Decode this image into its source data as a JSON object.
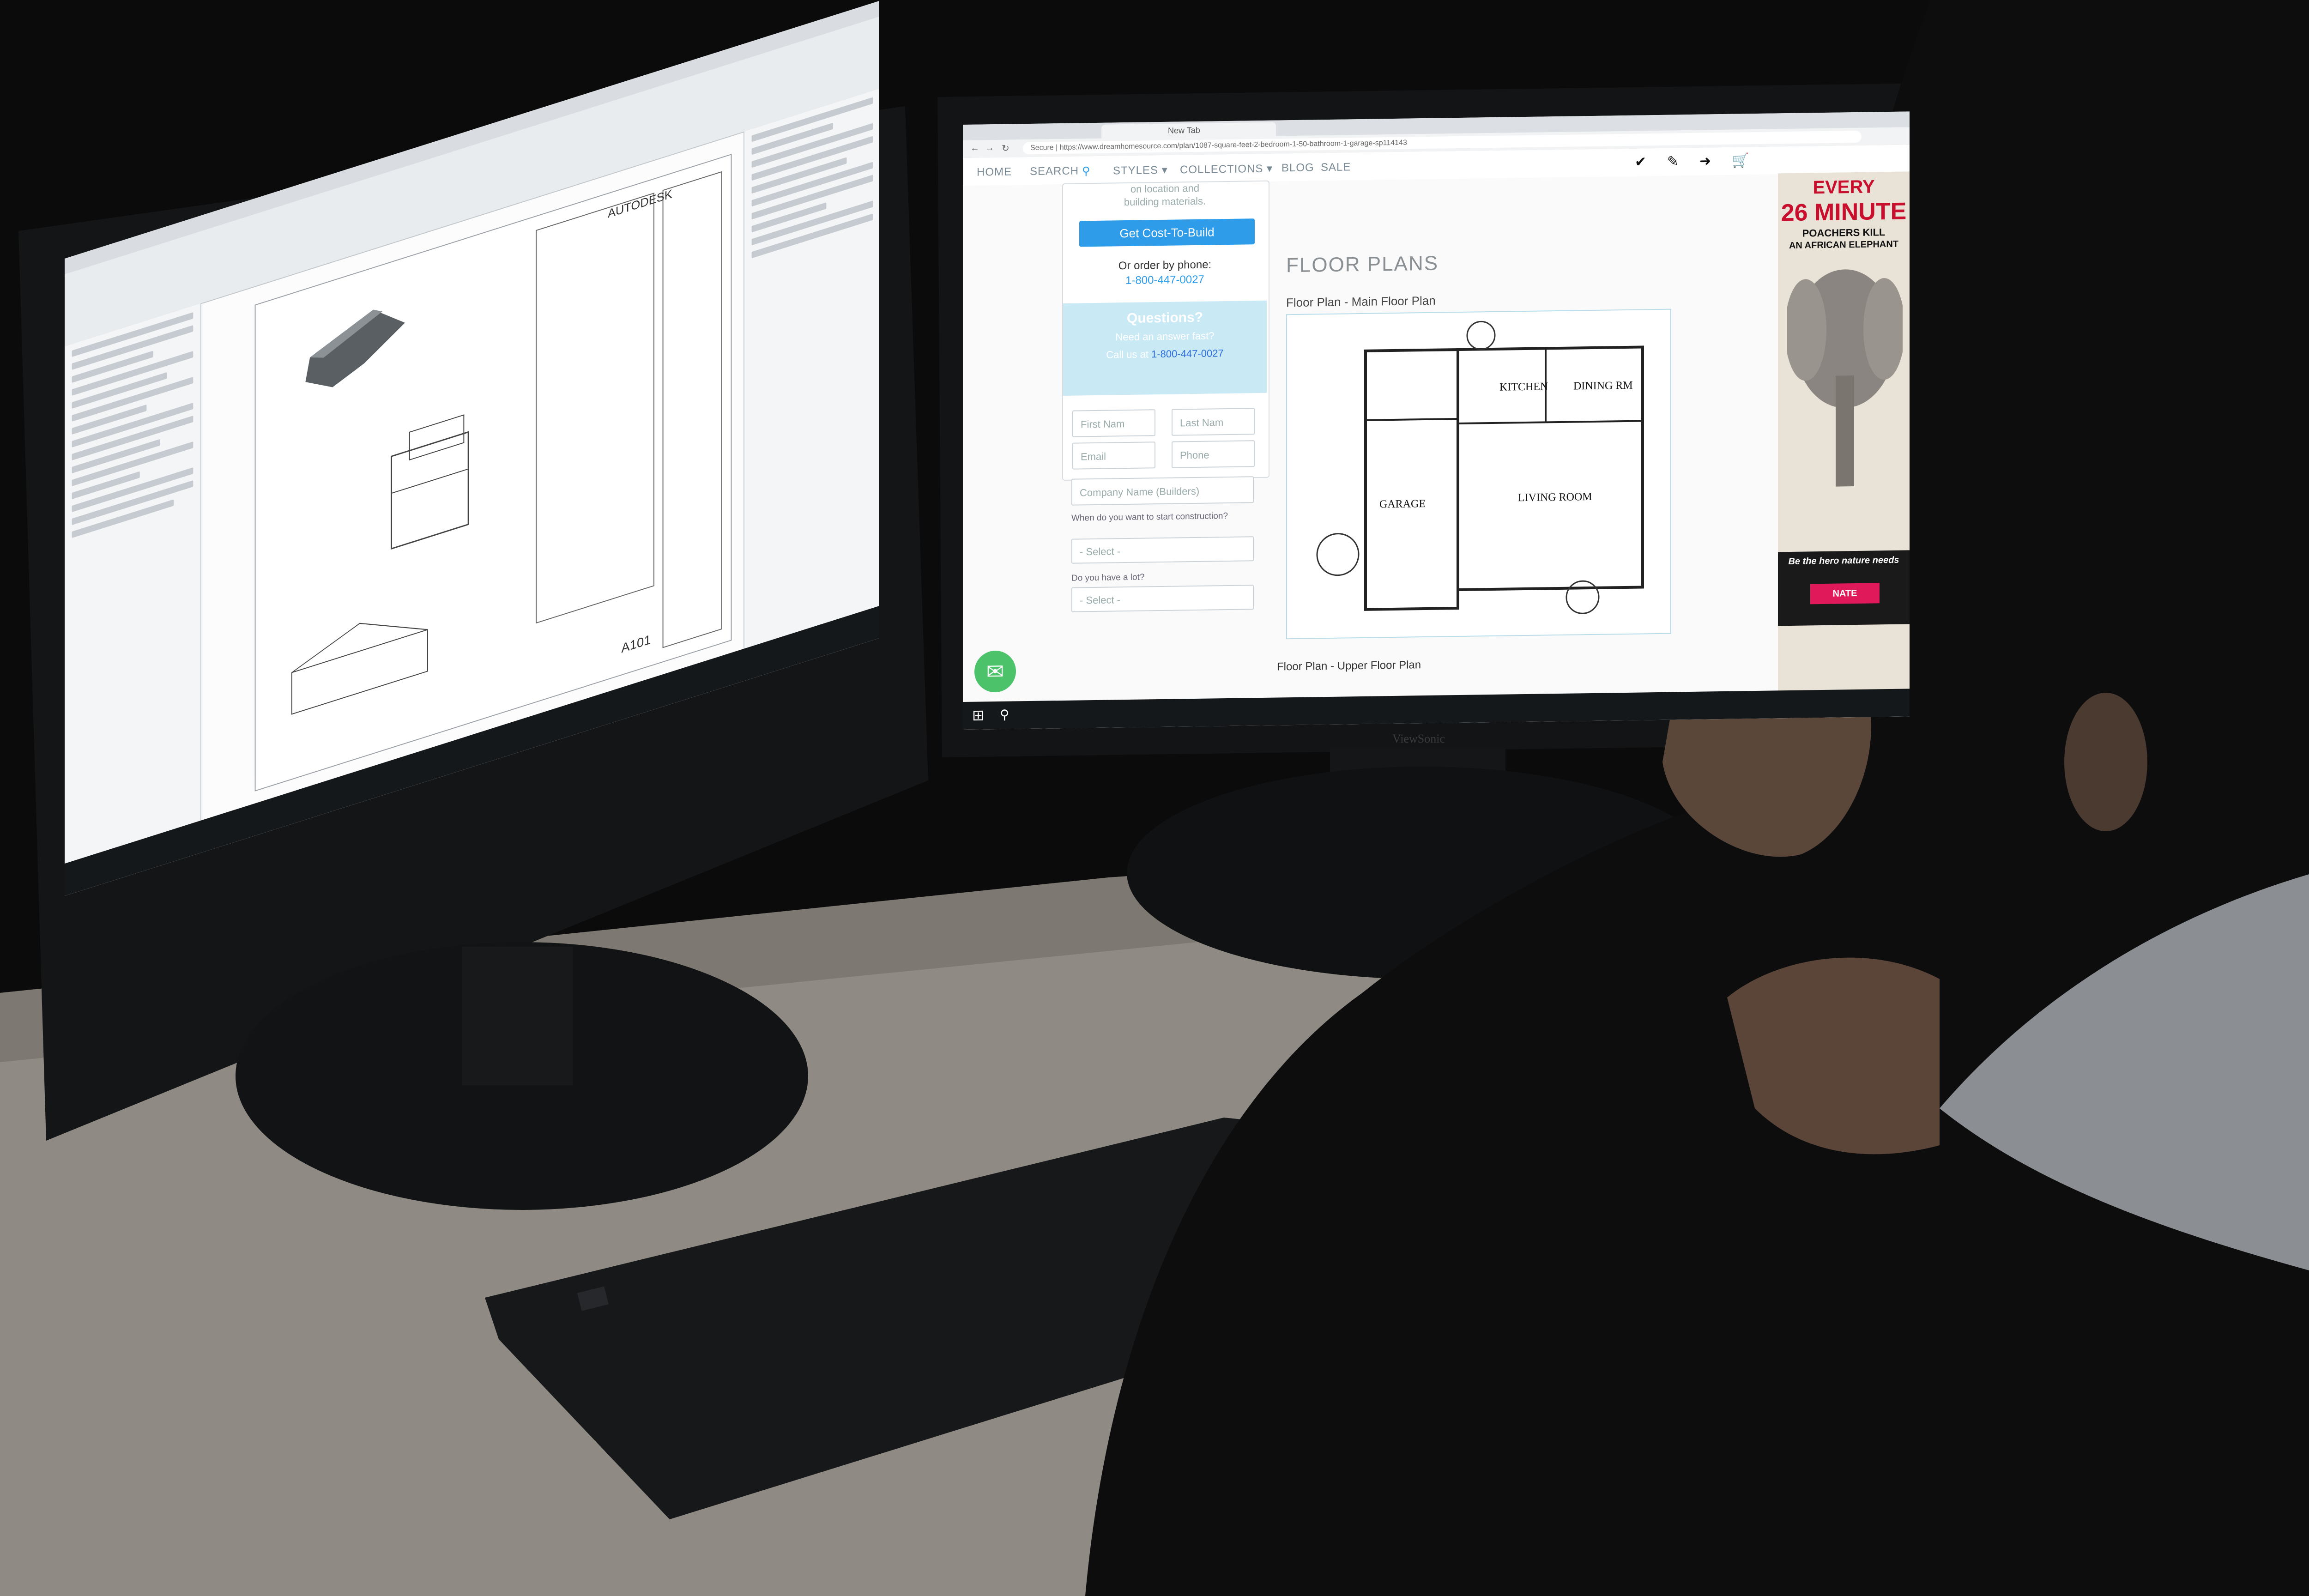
{
  "browser": {
    "tabs": [
      "",
      "New Tab"
    ],
    "address": "Secure  |  https://www.dreamhomesource.com/plan/1087-square-feet-2-bedroom-1-50-bathroom-1-garage-sp114143",
    "nav": {
      "home": "HOME",
      "search": "SEARCH",
      "styles": "STYLES ▾",
      "collections": "COLLECTIONS ▾",
      "blog": "BLOG",
      "sale": "SALE"
    },
    "sidebar": {
      "cost_note_1": "on location and",
      "cost_note_2": "building materials.",
      "cost_button": "Get Cost-To-Build",
      "order_phone_label": "Or order by phone:",
      "order_phone": "1-800-447-0027",
      "questions_title": "Questions?",
      "questions_sub": "Need an answer fast?",
      "call_text": "Call us at",
      "call_phone": "1-800-447-0027",
      "first_name": "First Nam",
      "last_name": "Last Nam",
      "email": "Email",
      "phone": "Phone",
      "company": "Company Name (Builders)",
      "q_when": "When do you want to start construction?",
      "select_placeholder": "- Select -",
      "q_lot": "Do you have a lot?"
    },
    "floor_plans": {
      "heading": "FLOOR PLANS",
      "main_caption": "Floor Plan - Main Floor Plan",
      "upper_caption": "Floor Plan - Upper Floor Plan",
      "rooms": [
        "KITCHEN",
        "DINING RM",
        "GARAGE",
        "LIVING ROOM"
      ]
    },
    "ad": {
      "line1": "EVERY",
      "line2": "26 MINUTE",
      "line3": "POACHERS KILL",
      "line4": "AN AFRICAN ELEPHANT",
      "tagline": "Be the hero nature needs",
      "cta": "NATE"
    }
  },
  "cad": {
    "brand": "AUTODESK",
    "sheet_id": "A101"
  },
  "monitor_brand": "ViewSonic",
  "colors": {
    "accent_blue": "#2e9ce8",
    "questions_bg": "#c9e9f5",
    "link_blue": "#2e9ce8"
  },
  "icons": [
    "search-icon",
    "check-icon",
    "pencil-icon",
    "arrow-right-icon",
    "cart-icon",
    "mail-icon",
    "windows-icon"
  ]
}
